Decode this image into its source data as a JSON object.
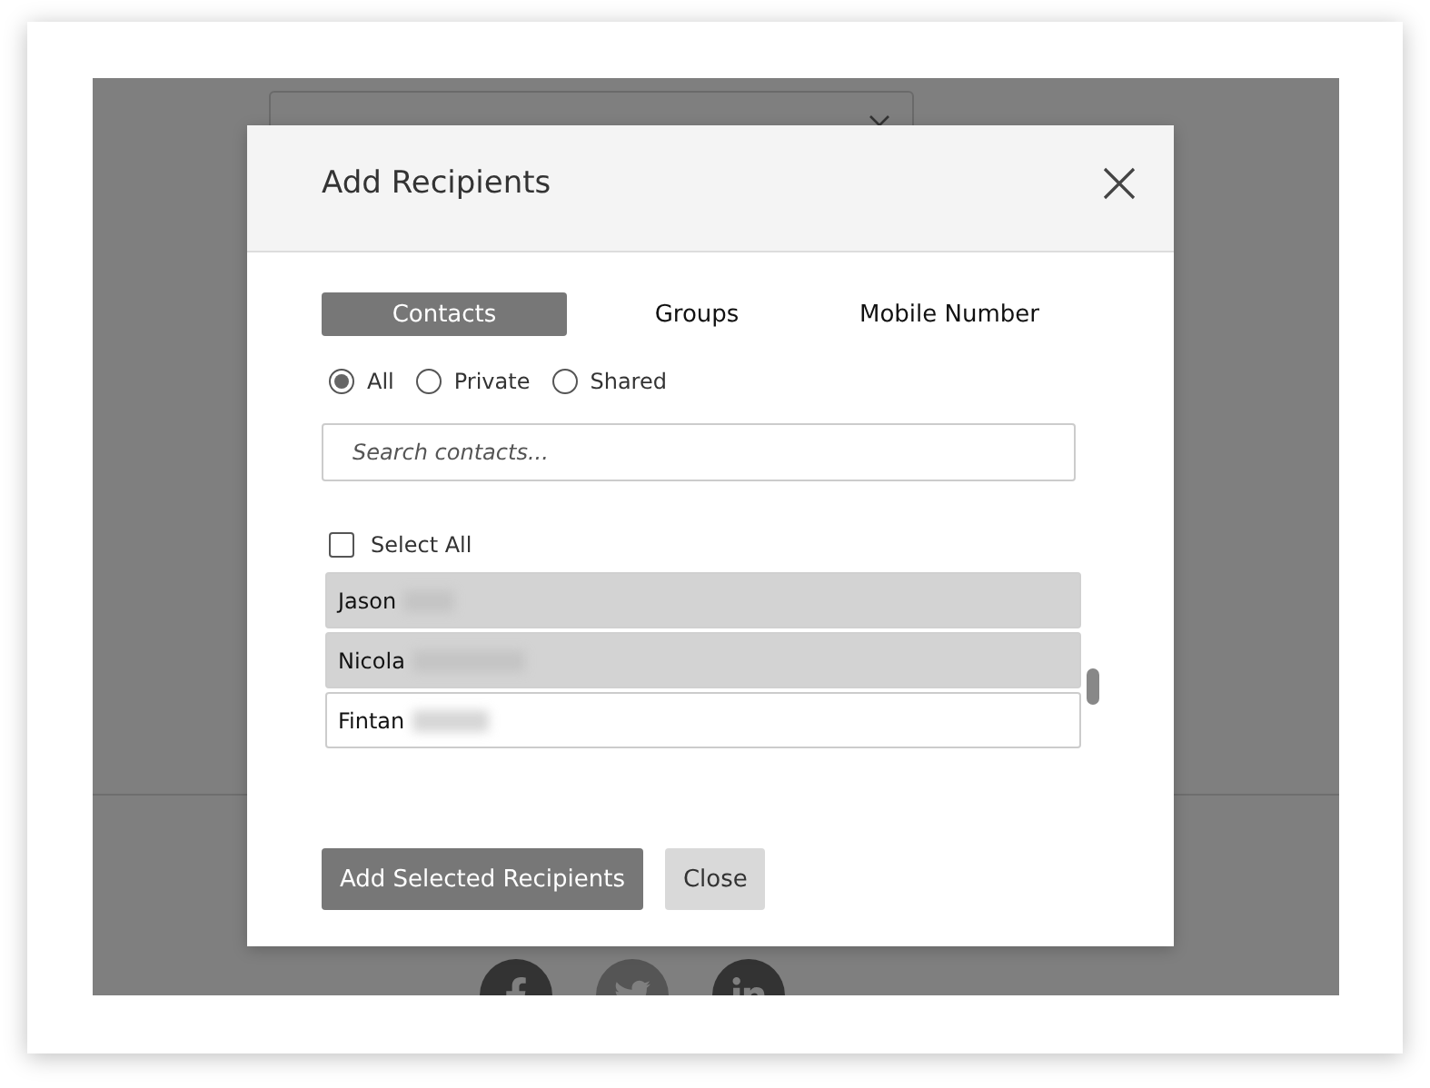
{
  "dialog": {
    "title": "Add Recipients",
    "tabs": [
      {
        "label": "Contacts",
        "selected": true
      },
      {
        "label": "Groups",
        "selected": false
      },
      {
        "label": "Mobile Number",
        "selected": false
      }
    ],
    "filters": [
      {
        "label": "All",
        "selected": true
      },
      {
        "label": "Private",
        "selected": false
      },
      {
        "label": "Shared",
        "selected": false
      }
    ],
    "search": {
      "placeholder": "Search contacts..."
    },
    "select_all": {
      "label": "Select All",
      "checked": false
    },
    "contacts": [
      {
        "name": "Jason",
        "selected": true
      },
      {
        "name": "Nicola",
        "selected": true
      },
      {
        "name": "Fintan",
        "selected": false
      }
    ],
    "buttons": [
      {
        "label": "Add Selected Recipients",
        "kind": "primary"
      },
      {
        "label": "Close",
        "kind": "secondary"
      }
    ]
  }
}
